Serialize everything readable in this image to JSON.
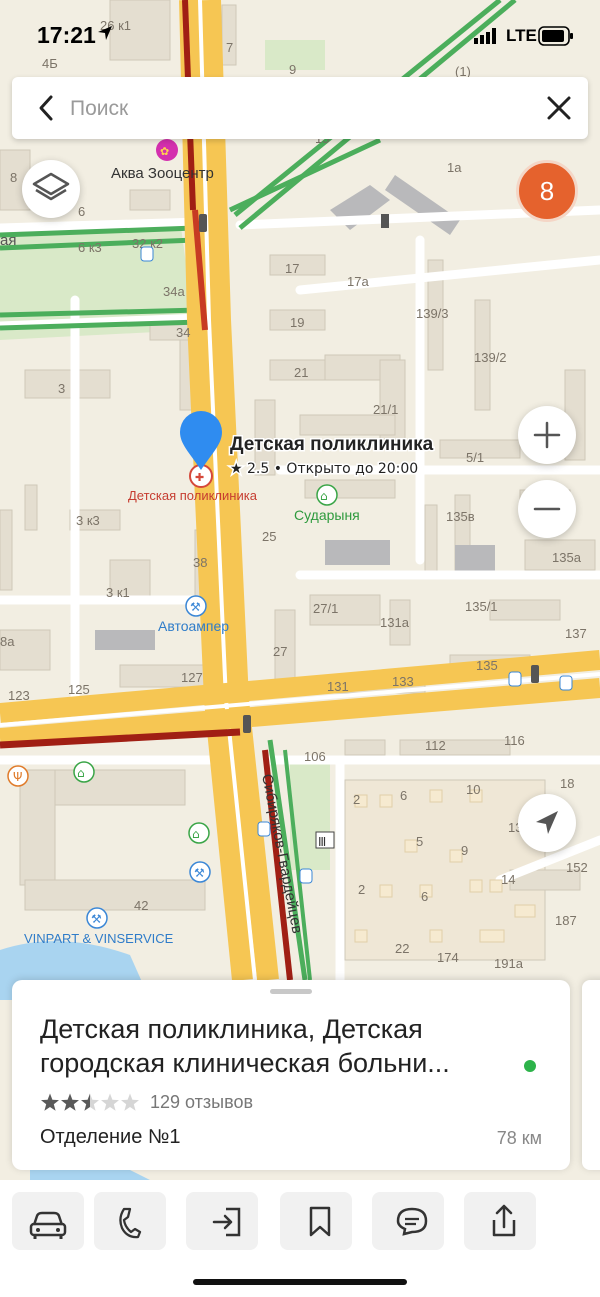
{
  "status_bar": {
    "time": "17:21",
    "network": "LTE"
  },
  "search": {
    "placeholder": "Поиск",
    "value": ""
  },
  "map": {
    "traffic_badge": "8",
    "selected_place": {
      "name": "Детская поликлиника",
      "rating_line": "★ 2.5 • Открыто до 20:00",
      "pin_label": "Детская поликлиника"
    },
    "poi": {
      "akva": "Аква Зооцентр",
      "sudarynya": "Сударыня",
      "avtoamper": "Автоампер",
      "vinpart": "VINPART & VINSERVICE"
    },
    "street": "Сибиряков-Гвардейцев",
    "left_street_partial": "ая",
    "house_numbers": {
      "h26k1": "26 к1",
      "h4b": "4Б",
      "h7": "7",
      "h9": "9",
      "h1top": "(1)",
      "h15": "15",
      "h1a": "1а",
      "h8": "8",
      "h6": "6",
      "h6k3": "6 к3",
      "h32k2": "32 к2",
      "h17": "17",
      "h17a": "17а",
      "h34a": "34а",
      "h139_3": "139/3",
      "h19": "19",
      "h34": "34",
      "h139_2": "139/2",
      "h3": "3",
      "h21": "21",
      "h21_1": "21/1",
      "h5_1": "5/1",
      "h3k3": "3 к3",
      "h25": "25",
      "h135v": "135в",
      "h135a": "135а",
      "h38": "38",
      "h3k1": "3 к1",
      "h27_1": "27/1",
      "h131a": "131а",
      "h135_1": "135/1",
      "h137": "137",
      "h8a": "8а",
      "h27": "27",
      "h135": "135",
      "h123": "123",
      "h125": "125",
      "h127": "127",
      "h131": "131",
      "h133": "133",
      "h106": "106",
      "h112": "112",
      "h116": "116",
      "h2a": "2",
      "h6a": "6",
      "h10": "10",
      "h18": "18",
      "h5": "5",
      "h9b": "9",
      "h13": "13",
      "h152": "152",
      "h2b": "2",
      "h6b": "6",
      "h14": "14",
      "h187": "187",
      "h42": "42",
      "h22": "22",
      "h174": "174",
      "h191a": "191а"
    }
  },
  "card": {
    "title": "Детская поликлиника, Детская городская клиническая больни...",
    "rating_stars": 2.5,
    "reviews": "129 отзывов",
    "subtitle": "Отделение №1",
    "distance": "78 км"
  },
  "toolbar": {
    "items": [
      "car-icon",
      "phone-icon",
      "enter-icon",
      "bookmark-icon",
      "chat-icon",
      "share-icon"
    ]
  },
  "colors": {
    "accent_blue": "#2f8cf0",
    "traffic_red": "#a01f14",
    "traffic_green": "#4cae5c",
    "badge_orange": "#e5622d",
    "main_road": "#f6c653"
  }
}
